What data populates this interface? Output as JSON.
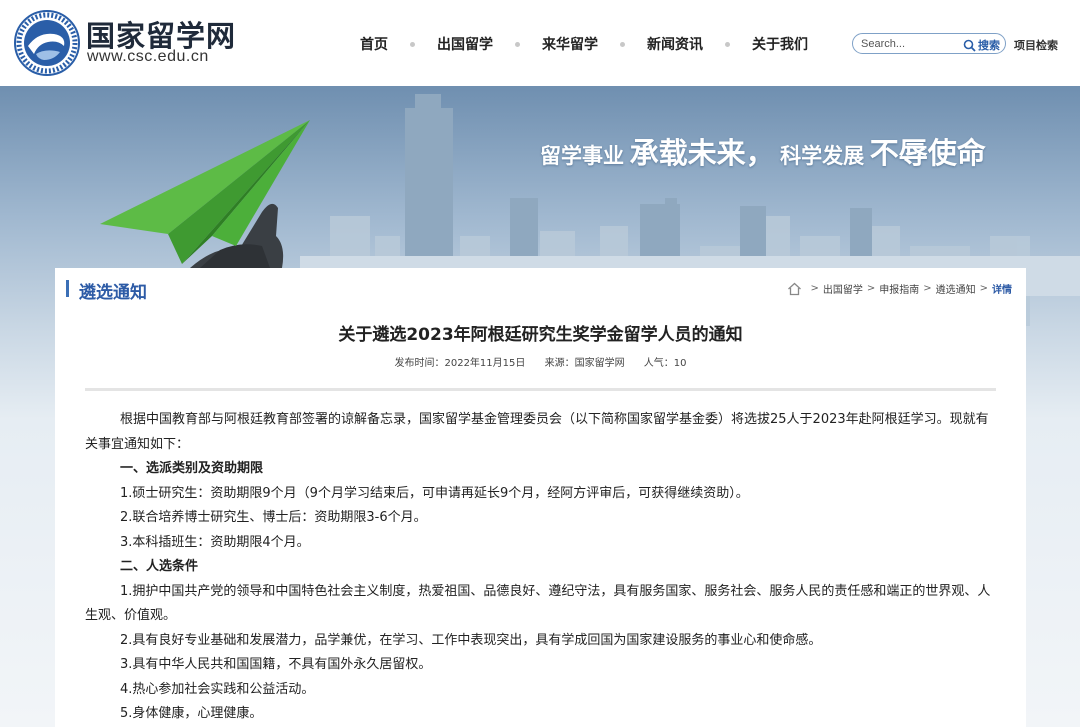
{
  "brand": {
    "logo_text": "CHINA SCHOLARSHIP COUNCIL · 国家留学基金管理委员会",
    "title": "国家留学网",
    "url": "www.csc.edu.cn"
  },
  "nav": {
    "items": [
      {
        "label": "首页"
      },
      {
        "label": "出国留学"
      },
      {
        "label": "来华留学"
      },
      {
        "label": "新闻资讯"
      },
      {
        "label": "关于我们"
      }
    ]
  },
  "search": {
    "placeholder": "Search...",
    "button_label": "搜索",
    "project_search_label": "项目检索"
  },
  "banner": {
    "slogan_part1": "留学事业",
    "slogan_part2": "承载未来，",
    "slogan_part3": "科学发展",
    "slogan_part4": "不辱使命"
  },
  "section": {
    "title": "遴选通知"
  },
  "breadcrumb": {
    "items": [
      "出国留学",
      "申报指南",
      "遴选通知"
    ],
    "current": "详情",
    "separator": ">"
  },
  "article": {
    "title": "关于遴选2023年阿根廷研究生奖学金留学人员的通知",
    "meta": {
      "publish_label": "发布时间：",
      "publish_date": "2022年11月15日",
      "source_label": "来源：",
      "source": "国家留学网",
      "views_label": "人气：",
      "views": "10"
    },
    "paragraphs": [
      "根据中国教育部与阿根廷教育部签署的谅解备忘录，国家留学基金管理委员会（以下简称国家留学基金委）将选拔25人于2023年赴阿根廷学习。现就有关事宜通知如下：",
      "一、选派类别及资助期限",
      "1.硕士研究生：资助期限9个月（9个月学习结束后，可申请再延长9个月，经阿方评审后，可获得继续资助）。",
      "2.联合培养博士研究生、博士后：资助期限3-6个月。",
      "3.本科插班生：资助期限4个月。",
      "二、人选条件",
      "1.拥护中国共产党的领导和中国特色社会主义制度，热爱祖国、品德良好、遵纪守法，具有服务国家、服务社会、服务人民的责任感和端正的世界观、人生观、价值观。",
      "2.具有良好专业基础和发展潜力，品学兼优，在学习、工作中表现突出，具有学成回国为国家建设服务的事业心和使命感。",
      "3.具有中华人民共和国国籍，不具有国外永久居留权。",
      "4.热心参加社会实践和公益活动。",
      "5.身体健康，心理健康。"
    ]
  },
  "colors": {
    "accent": "#2d5ba6",
    "plane_green": "#4caf3a",
    "divider": "#e4e4e4"
  }
}
